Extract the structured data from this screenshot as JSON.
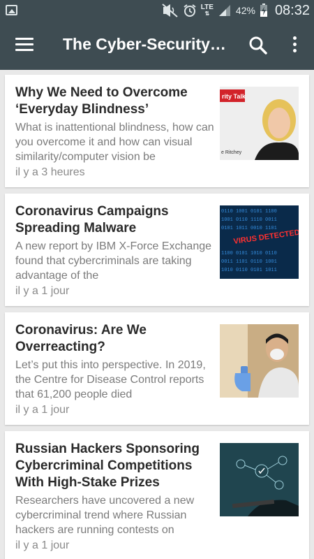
{
  "status_bar": {
    "left_icon": "image-icon",
    "icons": [
      "mute-icon",
      "alarm-icon",
      "lte-icon",
      "signal-icon",
      "battery-icon"
    ],
    "network": "LTE",
    "battery": "42%",
    "time": "08:32"
  },
  "app_bar": {
    "title": "The Cyber-Security…",
    "menu_icon": "hamburger-menu-icon",
    "search_icon": "search-icon",
    "more_icon": "more-vert-icon"
  },
  "articles": [
    {
      "title": "Why We Need to Overcome ‘Everyday Blindness’",
      "snippet": "What is inattentional blindness, how can you overcome it and how can visual similarity/computer vision be",
      "time": "il y a 3 heures",
      "thumb_caption": "rity Talk",
      "thumb_byline": "e Ritchey"
    },
    {
      "title": "Coronavirus Campaigns Spreading Malware",
      "snippet": "A new report by IBM X-Force Exchange found that cybercriminals are taking advantage of the",
      "time": "il y a 1 jour",
      "thumb_caption": "VIRUS DETECTED!"
    },
    {
      "title": "Coronavirus: Are We Overreacting?",
      "snippet": "Let’s put this into perspective. In 2019, the Centre for Disease Control reports that 61,200 people died",
      "time": "il y a 1 jour"
    },
    {
      "title": "Russian Hackers Sponsoring Cybercriminal Competitions With High-Stake Prizes",
      "snippet": "Researchers have uncovered a new cybercriminal trend where Russian hackers are running contests on",
      "time": "il y a 1 jour"
    }
  ]
}
